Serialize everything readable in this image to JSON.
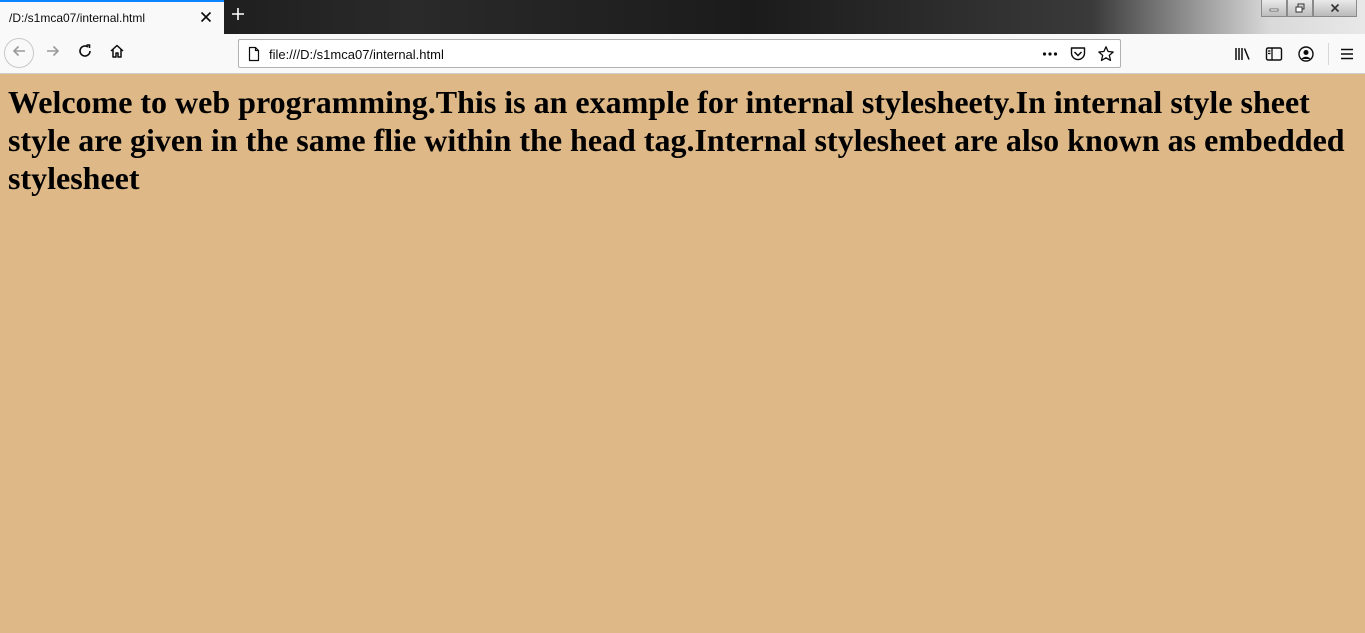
{
  "browser": {
    "tab": {
      "title": "/D:/s1mca07/internal.html"
    },
    "urlbar": {
      "url": "file:///D:/s1mca07/internal.html"
    },
    "icons": {
      "tab_close": "close-icon",
      "new_tab": "plus-icon",
      "back": "arrow-left-icon",
      "forward": "arrow-right-icon",
      "reload": "reload-icon",
      "home": "home-icon",
      "page": "page-icon",
      "page_actions": "more-horizontal-icon",
      "pocket": "pocket-icon",
      "bookmark": "star-icon",
      "library": "library-icon",
      "sidebar": "sidebar-icon",
      "account": "account-icon",
      "menu": "hamburger-menu-icon"
    },
    "accent_color": "#0a84ff"
  },
  "page": {
    "background_color": "#deb887",
    "heading": "Welcome to web programming.This is an example for internal stylesheety.In internal style sheet style are given in the same flie within the head tag.Internal stylesheet are also known as embedded stylesheet"
  }
}
